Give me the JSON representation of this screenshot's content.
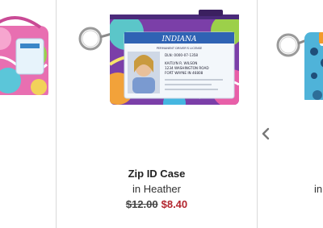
{
  "product": {
    "name": "Zip ID Case",
    "color_line": "in Heather",
    "price_original": "$12.00",
    "price_sale": "$8.40",
    "id_card": {
      "state": "INDIANA",
      "sub": "PERMANENT DRIVER'S LICENSE",
      "dln": "DLN: 0000-07-1358",
      "name": "KAITLYN R. WILSON",
      "address1": "1234 WASHINGTON ROAD",
      "address2": "FORT WAYNE IN 46808"
    }
  },
  "right_card": {
    "partial_text": "in"
  },
  "icons": {
    "carousel_prev": "chevron-left-icon"
  },
  "colors": {
    "sale_price": "#b3262e",
    "divider": "#d9d9d9",
    "text": "#222222"
  }
}
